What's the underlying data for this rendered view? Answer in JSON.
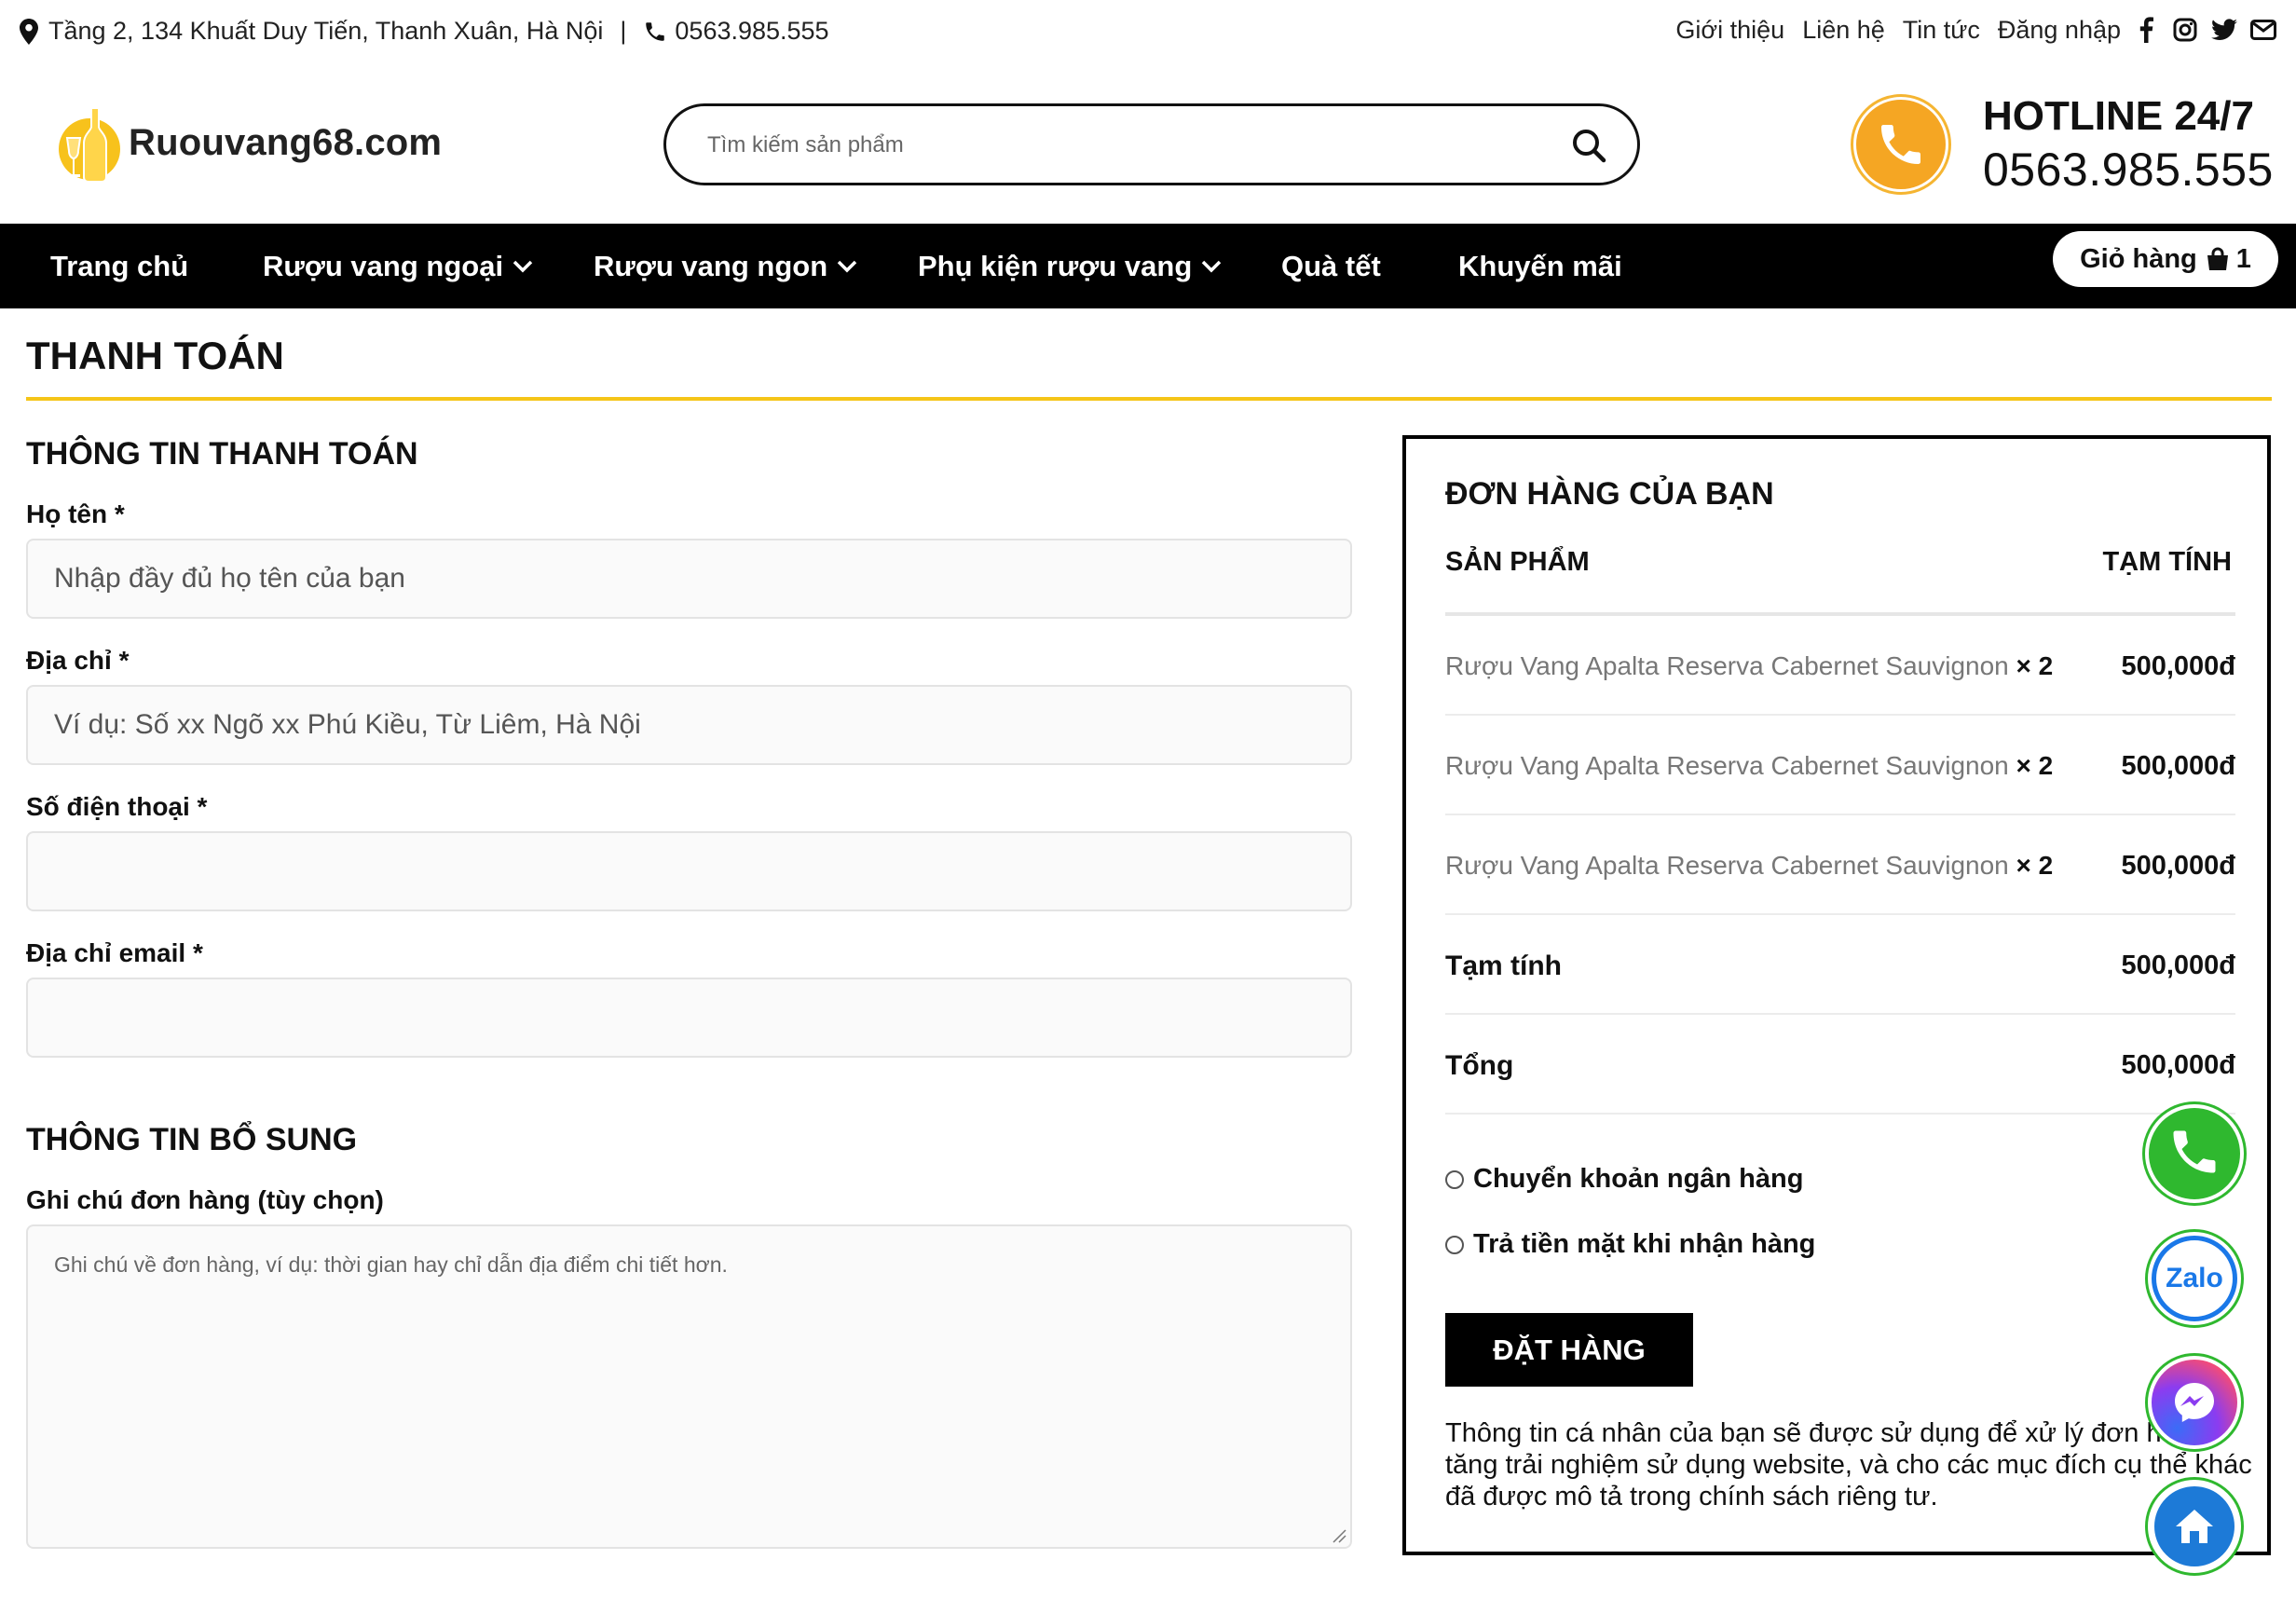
{
  "topbar": {
    "address": "Tầng 2, 134 Khuất Duy Tiến, Thanh Xuân, Hà Nội",
    "separator": "|",
    "phone": "0563.985.555",
    "links": [
      "Giới thiệu",
      "Liên hệ",
      "Tin tức",
      "Đăng nhập"
    ],
    "social_icons": [
      "facebook-icon",
      "instagram-icon",
      "twitter-icon",
      "mail-icon"
    ]
  },
  "header": {
    "logo_text": "Ruouvang68.com",
    "search_placeholder": "Tìm kiếm sản phẩm",
    "hotline_label": "HOTLINE 24/7",
    "hotline_number": "0563.985.555"
  },
  "nav": {
    "items": [
      "Trang chủ",
      "Rượu vang ngoại",
      "Rượu vang ngon",
      "Phụ kiện rượu vang",
      "Quà tết",
      "Khuyến mãi"
    ],
    "cart_label": "Giỏ hàng",
    "cart_count": "1"
  },
  "page": {
    "title": "THANH TOÁN"
  },
  "billing": {
    "section_title": "THÔNG TIN THANH TOÁN",
    "name_label": "Họ tên *",
    "name_placeholder": "Nhập đầy đủ họ tên của bạn",
    "address_label": "Địa chỉ *",
    "address_placeholder": "Ví dụ: Số xx Ngõ xx Phú Kiều, Từ Liêm, Hà Nội",
    "phone_label": "Số điện thoại *",
    "phone_placeholder": "",
    "email_label": "Địa chỉ email *",
    "email_placeholder": ""
  },
  "additional": {
    "section_title": "THÔNG TIN BỔ SUNG",
    "notes_label": "Ghi chú đơn hàng (tùy chọn)",
    "notes_placeholder": "Ghi chú về đơn hàng, ví dụ: thời gian hay chỉ dẫn địa điểm chi tiết hơn."
  },
  "order": {
    "title": "ĐƠN HÀNG CỦA BẠN",
    "col_product": "SẢN PHẨM",
    "col_subtotal": "TẠM TÍNH",
    "items": [
      {
        "name": "Rượu Vang Apalta Reserva Cabernet Sauvignon",
        "qty": "× 2",
        "price": "500,000đ"
      },
      {
        "name": "Rượu Vang Apalta Reserva Cabernet Sauvignon",
        "qty": "× 2",
        "price": "500,000đ"
      },
      {
        "name": "Rượu Vang Apalta Reserva Cabernet Sauvignon",
        "qty": "× 2",
        "price": "500,000đ"
      }
    ],
    "subtotal_label": "Tạm tính",
    "subtotal_value": "500,000đ",
    "total_label": "Tổng",
    "total_value": "500,000đ",
    "payment_options": [
      "Chuyển khoản ngân hàng",
      "Trả tiền mặt khi nhận hàng"
    ],
    "place_order": "ĐẶT HÀNG",
    "privacy_notice": "Thông tin cá nhân của bạn sẽ được sử dụng để xử lý đơn hàng, tăng trải nghiệm sử dụng website, và cho các mục đích cụ thể khác đã được mô tả trong chính sách riêng tư."
  },
  "floating": {
    "zalo_label": "Zalo",
    "icons": [
      "phone-icon",
      "zalo-icon",
      "messenger-icon",
      "home-icon"
    ]
  },
  "colors": {
    "accent_yellow": "#f5c518",
    "nav_bg": "#000000",
    "hotline_orange": "#f5a623",
    "fab_green": "#2fb82f",
    "zalo_blue": "#1a78e8"
  }
}
